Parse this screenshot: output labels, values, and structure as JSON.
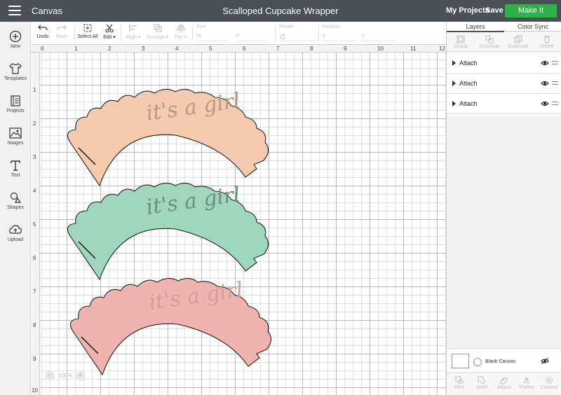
{
  "header": {
    "app_name": "Canvas",
    "doc_title": "Scalloped Cupcake Wrapper",
    "my_projects": "My Projects",
    "save": "Save",
    "make_it": "Make It"
  },
  "sidebar": {
    "items": [
      {
        "label": "New",
        "icon": "plus-circle-icon"
      },
      {
        "label": "Templates",
        "icon": "tshirt-icon"
      },
      {
        "label": "Projects",
        "icon": "projects-icon"
      },
      {
        "label": "Images",
        "icon": "images-icon"
      },
      {
        "label": "Text",
        "icon": "text-icon"
      },
      {
        "label": "Shapes",
        "icon": "shapes-icon"
      },
      {
        "label": "Upload",
        "icon": "upload-icon"
      }
    ]
  },
  "toolbar": {
    "undo": "Undo",
    "redo": "Redo",
    "select_all": "Select All",
    "edit": "Edit",
    "align": "Align",
    "arrange": "Arrange",
    "flip": "Flip",
    "size_label": "Size",
    "w_label": "W",
    "h_label": "H",
    "rotate_label": "Rotate",
    "position_label": "Position",
    "x_label": "X",
    "y_label": "Y"
  },
  "rulers": {
    "top": [
      "0",
      "1",
      "2",
      "3",
      "4",
      "5",
      "6",
      "7",
      "8",
      "9",
      "10",
      "11",
      "12"
    ],
    "left": [
      "1",
      "2",
      "3",
      "4",
      "5",
      "6",
      "7",
      "8",
      "9",
      "10"
    ]
  },
  "canvas": {
    "wrapper_text": "it's a girl",
    "wrappers": [
      {
        "fill": "#f5cbb0",
        "text_color": "#b89a86"
      },
      {
        "fill": "#9fd6be",
        "text_color": "#6f8f7e"
      },
      {
        "fill": "#efb4b0",
        "text_color": "#d69e9b"
      }
    ],
    "zoom": "100%"
  },
  "panel": {
    "tabs": [
      "Layers",
      "Color Sync"
    ],
    "tools": [
      "Group",
      "UnGroup",
      "Duplicate",
      "Delete"
    ],
    "layers": [
      {
        "name": "Attach"
      },
      {
        "name": "Attach"
      },
      {
        "name": "Attach"
      }
    ],
    "blank_canvas": "Blank Canvas",
    "bottom_tools": [
      "Slice",
      "Weld",
      "Attach",
      "Flatten",
      "Contour"
    ]
  },
  "colors": {
    "header_bg": "#4a5056",
    "make_it_green": "#2fb24a"
  }
}
